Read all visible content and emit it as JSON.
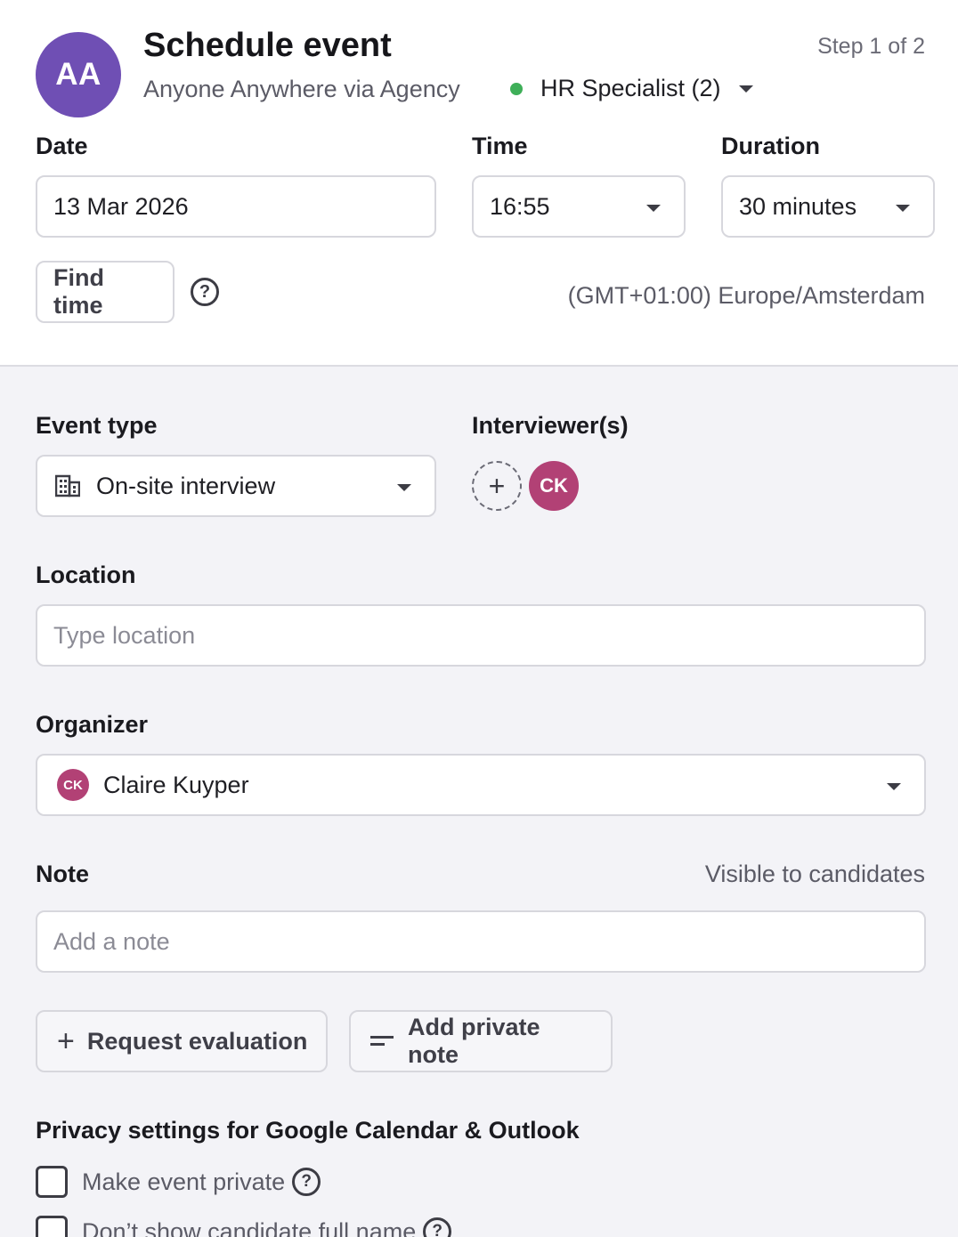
{
  "header": {
    "avatar_initials": "AA",
    "title": "Schedule event",
    "subtitle": "Anyone Anywhere via Agency",
    "step": "Step 1 of 2",
    "job_label": "HR Specialist (2)",
    "job_status_color": "#3eaf58"
  },
  "schedule": {
    "date_label": "Date",
    "date_value": "13 Mar 2026",
    "time_label": "Time",
    "time_value": "16:55",
    "duration_label": "Duration",
    "duration_value": "30 minutes",
    "find_time_label": "Find time",
    "timezone": "(GMT+01:00) Europe/Amsterdam"
  },
  "event": {
    "event_type_label": "Event type",
    "event_type_value": "On-site interview",
    "interviewers_label": "Interviewer(s)",
    "interviewer_initials": "CK",
    "location_label": "Location",
    "location_placeholder": "Type location",
    "organizer_label": "Organizer",
    "organizer_initials": "CK",
    "organizer_name": "Claire Kuyper",
    "note_label": "Note",
    "note_visibility": "Visible to candidates",
    "note_placeholder": "Add a note",
    "request_evaluation_label": "Request evaluation",
    "add_private_note_label": "Add private note"
  },
  "privacy": {
    "heading": "Privacy settings for Google Calendar & Outlook",
    "make_private_label": "Make event private",
    "hide_name_label": "Don’t show candidate full name"
  },
  "colors": {
    "avatar_purple": "#6f4fb4",
    "interviewer_pink": "#b24175"
  }
}
